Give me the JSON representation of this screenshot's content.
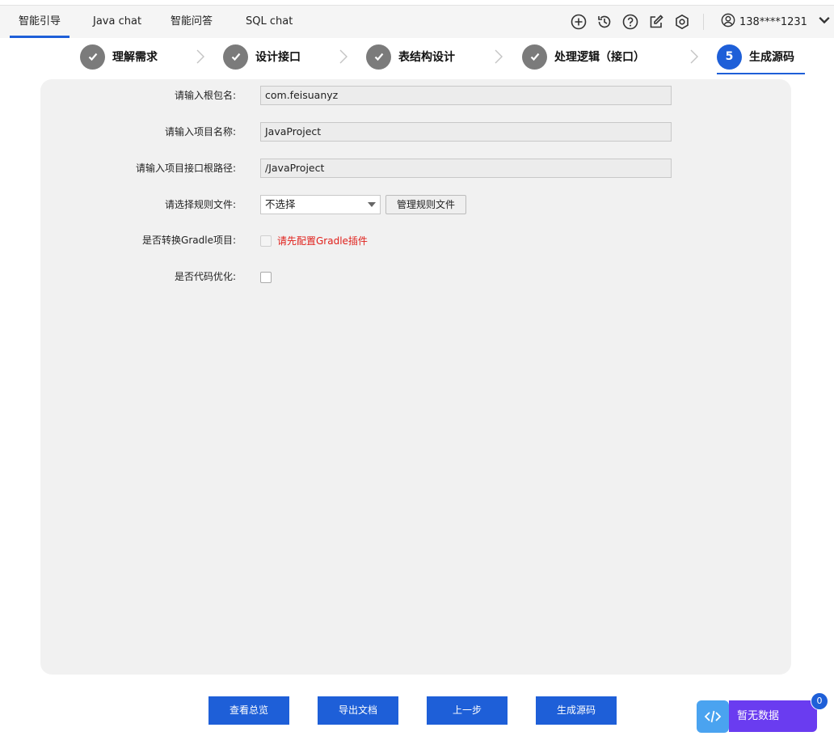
{
  "tabs": [
    {
      "label": "智能引导",
      "active": true
    },
    {
      "label": "Java chat",
      "active": false
    },
    {
      "label": "智能问答",
      "active": false
    },
    {
      "label": "SQL chat",
      "active": false
    }
  ],
  "toolbar_icons": [
    "plus-circle-icon",
    "history-icon",
    "help-icon",
    "edit-icon",
    "settings-icon"
  ],
  "user": {
    "name": "138****1231"
  },
  "steps": [
    {
      "label": "理解需求",
      "state": "done"
    },
    {
      "label": "设计接口",
      "state": "done"
    },
    {
      "label": "表结构设计",
      "state": "done"
    },
    {
      "label": "处理逻辑（接口）",
      "state": "done"
    },
    {
      "label": "生成源码",
      "state": "active",
      "number": "5"
    }
  ],
  "form": {
    "package_label": "请输入根包名:",
    "package_value": "com.feisuanyz",
    "project_name_label": "请输入项目名称:",
    "project_name_value": "JavaProject",
    "root_path_label": "请输入项目接口根路径:",
    "root_path_value": "/JavaProject",
    "rule_file_label": "请选择规则文件:",
    "rule_file_value": "不选择",
    "manage_rules_label": "管理规则文件",
    "gradle_label": "是否转换Gradle项目:",
    "gradle_warning": "请先配置Gradle插件",
    "optimize_label": "是否代码优化:"
  },
  "actions": {
    "overview": "查看总览",
    "export": "导出文档",
    "prev": "上一步",
    "generate": "生成源码"
  },
  "widget": {
    "nodata": "暂无数据",
    "badge": "0"
  },
  "colors": {
    "accent": "#1e5fd8",
    "step_done": "#7b7b7b",
    "warning": "#e0201b",
    "widget": "#6a3cf0"
  }
}
